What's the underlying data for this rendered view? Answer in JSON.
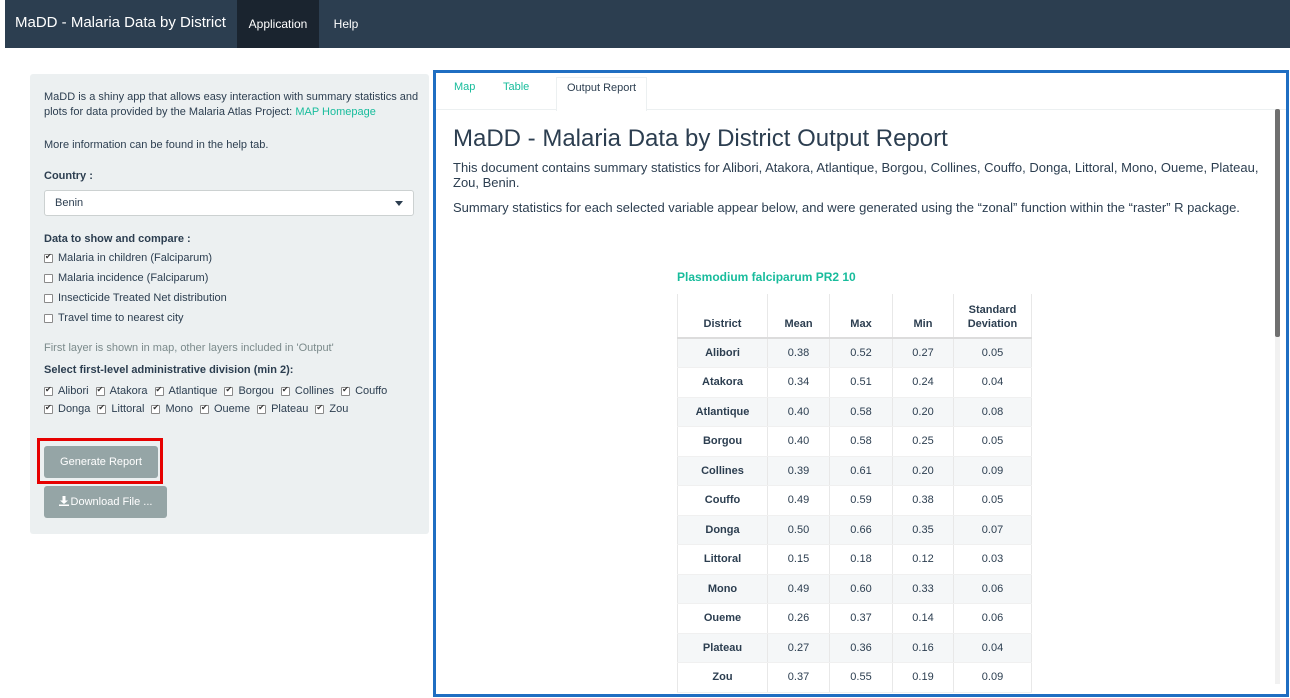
{
  "navbar": {
    "brand": "MaDD - Malaria Data by District",
    "tabs": [
      "Application",
      "Help"
    ]
  },
  "sidebar": {
    "intro_text": "MaDD is a shiny app that allows easy interaction with summary statistics and plots for data provided by the Malaria Atlas Project: ",
    "intro_link": "MAP Homepage",
    "more_info": "More information can be found in the help tab.",
    "country_label": "Country :",
    "country_value": "Benin",
    "data_label": "Data to show and compare :",
    "data_options": [
      {
        "label": "Malaria in children (Falciparum)",
        "checked": true
      },
      {
        "label": "Malaria incidence (Falciparum)",
        "checked": false
      },
      {
        "label": "Insecticide Treated Net distribution",
        "checked": false
      },
      {
        "label": "Travel time to nearest city",
        "checked": false
      }
    ],
    "note": "First layer is shown in map, other layers included in 'Output'",
    "admin_label": "Select first-level administrative division (min 2):",
    "admin_options": [
      "Alibori",
      "Atakora",
      "Atlantique",
      "Borgou",
      "Collines",
      "Couffo",
      "Donga",
      "Littoral",
      "Mono",
      "Oueme",
      "Plateau",
      "Zou"
    ],
    "generate_button": "Generate Report",
    "download_button": "Download File ...",
    "download_icon": "download-icon"
  },
  "main": {
    "tabs": [
      "Map",
      "Table",
      "Output Report"
    ],
    "active_tab": "Output Report",
    "report_title": "MaDD - Malaria Data by District Output Report",
    "paragraph_1": "This document contains summary statistics for Alibori, Atakora, Atlantique, Borgou, Collines, Couffo, Donga, Littoral, Mono, Oueme, Plateau, Zou, Benin.",
    "paragraph_2": "Summary statistics for each selected variable appear below, and were generated using the “zonal” function within the “raster” R package.",
    "table_caption": "Plasmodium falciparum PR2 10",
    "table_headers": [
      "District",
      "Mean",
      "Max",
      "Min",
      "Standard Deviation"
    ],
    "table_rows": [
      [
        "Alibori",
        "0.38",
        "0.52",
        "0.27",
        "0.05"
      ],
      [
        "Atakora",
        "0.34",
        "0.51",
        "0.24",
        "0.04"
      ],
      [
        "Atlantique",
        "0.40",
        "0.58",
        "0.20",
        "0.08"
      ],
      [
        "Borgou",
        "0.40",
        "0.58",
        "0.25",
        "0.05"
      ],
      [
        "Collines",
        "0.39",
        "0.61",
        "0.20",
        "0.09"
      ],
      [
        "Couffo",
        "0.49",
        "0.59",
        "0.38",
        "0.05"
      ],
      [
        "Donga",
        "0.50",
        "0.66",
        "0.35",
        "0.07"
      ],
      [
        "Littoral",
        "0.15",
        "0.18",
        "0.12",
        "0.03"
      ],
      [
        "Mono",
        "0.49",
        "0.60",
        "0.33",
        "0.06"
      ],
      [
        "Oueme",
        "0.26",
        "0.37",
        "0.14",
        "0.06"
      ],
      [
        "Plateau",
        "0.27",
        "0.36",
        "0.16",
        "0.04"
      ],
      [
        "Zou",
        "0.37",
        "0.55",
        "0.19",
        "0.09"
      ]
    ]
  },
  "colors": {
    "navbar": "#2c3e50",
    "accent": "#18bc9c",
    "sidebar_bg": "#ecf0f1",
    "button": "#95a5a6",
    "highlight_outline": "#e60000",
    "panel_border": "#1f6ec2"
  }
}
